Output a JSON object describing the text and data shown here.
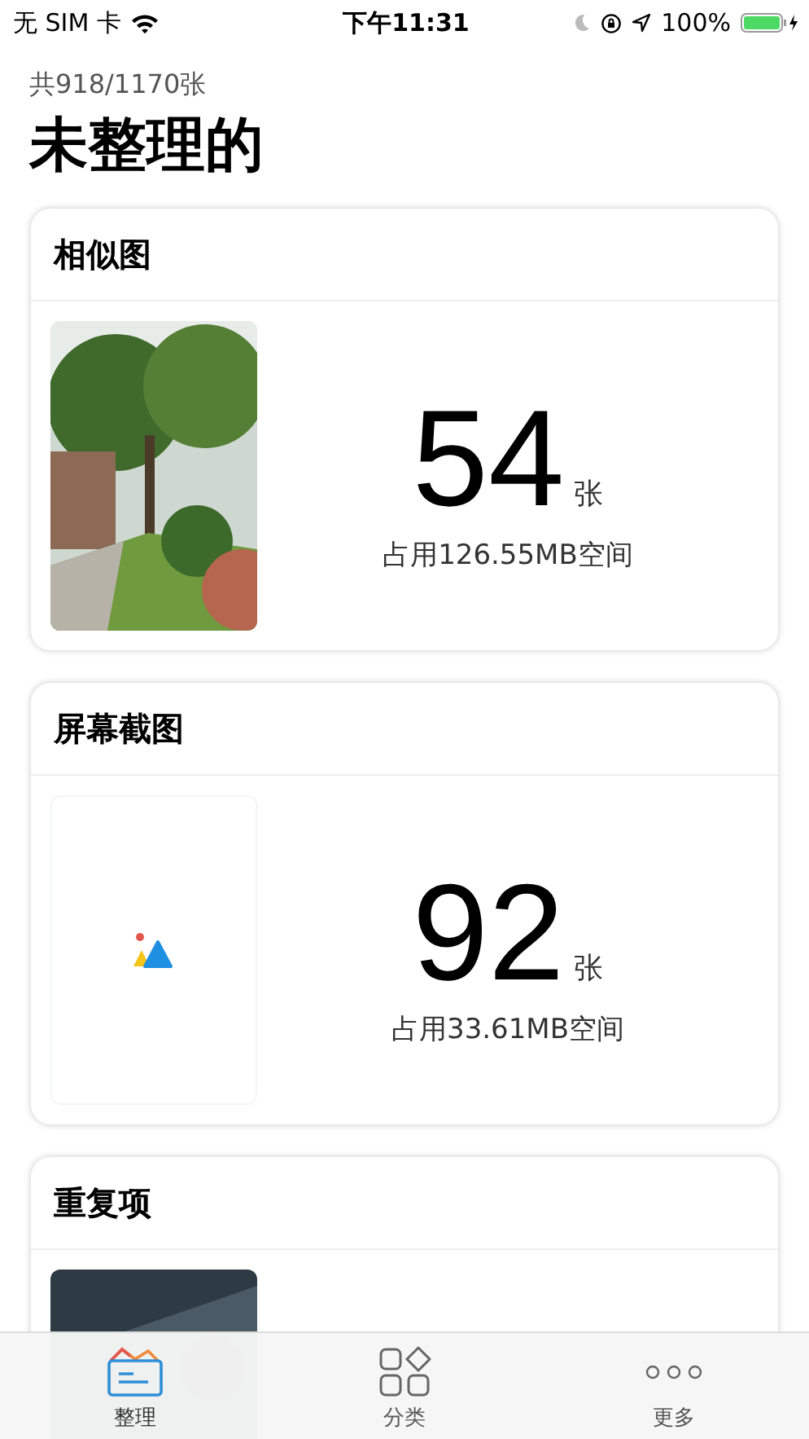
{
  "status_bar": {
    "carrier": "无 SIM 卡",
    "time": "下午11:31",
    "battery": "100%"
  },
  "header": {
    "subtitle": "共918/1170张",
    "title": "未整理的"
  },
  "cards": [
    {
      "title": "相似图",
      "count": "54",
      "unit": "张",
      "usage": "占用126.55MB空间"
    },
    {
      "title": "屏幕截图",
      "thumb": {
        "kind": "placeholder"
      },
      "count": "92",
      "unit": "张",
      "usage": "占用33.61MB空间"
    },
    {
      "title": "重复项"
    }
  ],
  "tabs": [
    {
      "label": "整理",
      "selected": true
    },
    {
      "label": "分类",
      "selected": false
    },
    {
      "label": "更多",
      "selected": false
    }
  ]
}
